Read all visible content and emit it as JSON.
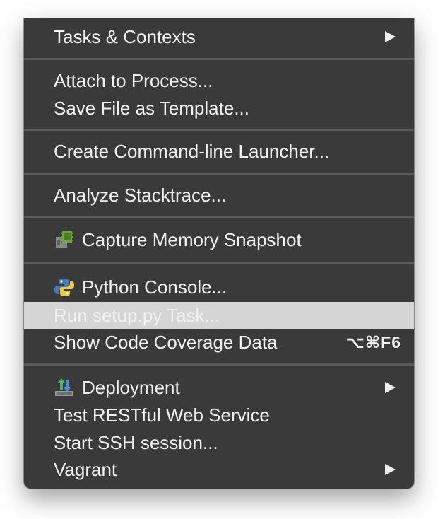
{
  "menu": {
    "items": [
      {
        "label": "Tasks & Contexts",
        "submenu": true
      },
      {
        "label": "Attach to Process..."
      },
      {
        "label": "Save File as Template..."
      },
      {
        "label": "Create Command-line Launcher..."
      },
      {
        "label": "Analyze Stacktrace..."
      },
      {
        "label": "Capture Memory Snapshot",
        "icon": "memory-snapshot-icon"
      },
      {
        "label": "Python Console...",
        "icon": "python-icon"
      },
      {
        "label": "Run setup.py Task...",
        "highlighted": true
      },
      {
        "label": "Show Code Coverage Data",
        "shortcut": "⌥⌘F6"
      },
      {
        "label": "Deployment",
        "icon": "deployment-icon",
        "submenu": true
      },
      {
        "label": "Test RESTful Web Service"
      },
      {
        "label": "Start SSH session..."
      },
      {
        "label": "Vagrant",
        "submenu": true
      }
    ]
  },
  "colors": {
    "menu_background": "#3a3a3a",
    "separator": "#5c5c5c",
    "highlight": "#d5d5d5",
    "text": "#f2f2f2"
  }
}
